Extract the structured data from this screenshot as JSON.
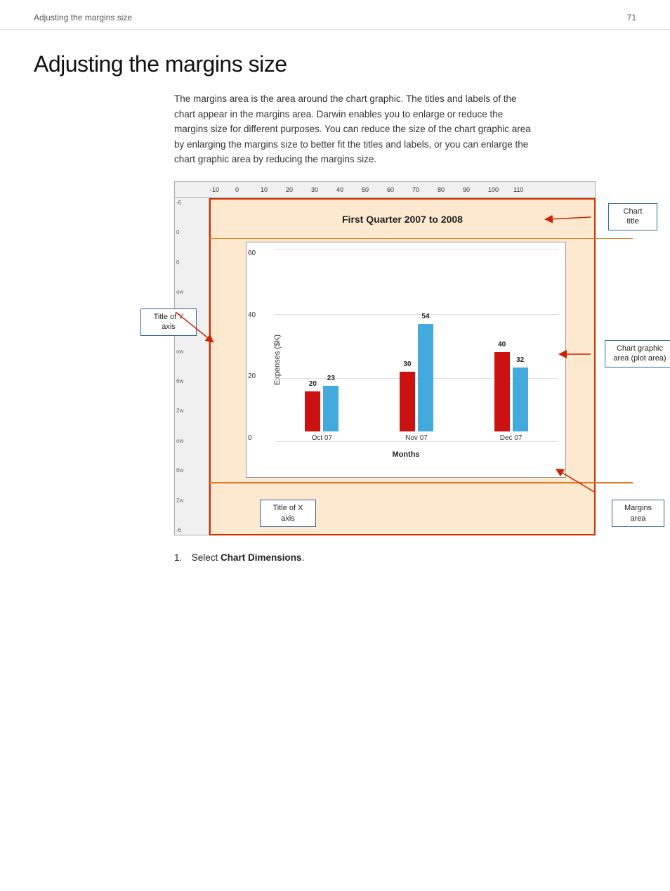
{
  "header": {
    "breadcrumb": "Adjusting the margins size",
    "page_number": "71"
  },
  "page": {
    "title": "Adjusting the margins size",
    "intro": "The margins area is the area around the chart graphic. The titles and labels of the chart appear in the margins area. Darwin enables you to enlarge or reduce the margins size for different purposes. You can reduce the size of the chart graphic area by enlarging the margins size to better fit the titles and labels, or you can enlarge the chart graphic area by reducing the margins size."
  },
  "chart": {
    "title": "First Quarter 2007 to 2008",
    "y_axis_title": "Expenses ($K)",
    "x_axis_title": "Months",
    "x_labels": [
      "Oct 07",
      "Nov 07",
      "Dec 07"
    ],
    "y_labels": [
      "0",
      "20",
      "40",
      "60"
    ],
    "bars": [
      {
        "month": "Oct 07",
        "red": 20,
        "blue": 23
      },
      {
        "month": "Nov 07",
        "red": 30,
        "blue": 54
      },
      {
        "month": "Dec 07",
        "red": 40,
        "blue": 32
      }
    ],
    "max_value": 60
  },
  "annotations": {
    "chart_title_label": "Chart\ntitle",
    "y_axis_label": "Title of Y\naxis",
    "x_axis_label": "Title of X\naxis",
    "chart_graphic_label": "Chart graphic\narea (plot area)",
    "margins_area_label": "Margins\narea"
  },
  "ruler": {
    "top_marks": [
      "-10",
      "0",
      "10",
      "20",
      "30",
      "40",
      "50",
      "60",
      "70",
      "80",
      "90",
      "100",
      "110"
    ]
  },
  "step1": {
    "prefix": "1. Select ",
    "bold": "Chart Dimensions",
    "suffix": "."
  }
}
